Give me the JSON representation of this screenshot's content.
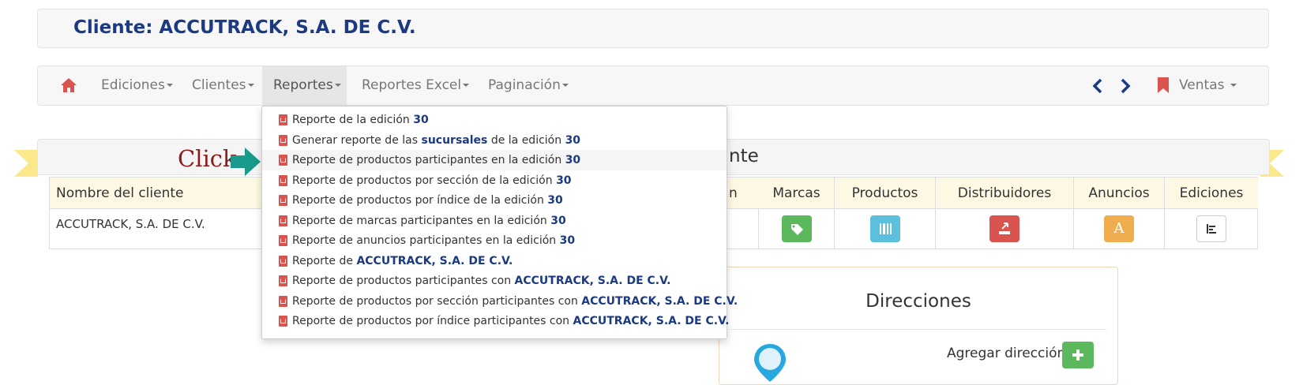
{
  "header": {
    "title": "Cliente: ACCUTRACK, S.A. DE C.V."
  },
  "navbar": {
    "items": [
      "Ediciones",
      "Clientes",
      "Reportes",
      "Reportes Excel",
      "Paginación"
    ],
    "right_label": "Ventas",
    "colors": {
      "home": "#d9534f",
      "arrows": "#1b3a82",
      "bookmark": "#d9534f"
    }
  },
  "dropdown": {
    "items": [
      {
        "text": "Reporte de la edición ",
        "bold": "30"
      },
      {
        "text": "Generar reporte de las ",
        "bold": "sucursales",
        "text2": " de la edición ",
        "bold2": "30"
      },
      {
        "text": "Reporte de productos participantes en la edición ",
        "bold": "30"
      },
      {
        "text": "Reporte de productos por sección de la edición ",
        "bold": "30"
      },
      {
        "text": "Reporte de productos por índice de la edición ",
        "bold": "30"
      },
      {
        "text": "Reporte de marcas participantes en la edición ",
        "bold": "30"
      },
      {
        "text": "Reporte de anuncios participantes en la edición ",
        "bold": "30"
      },
      {
        "text": "Reporte de ",
        "bold": "ACCUTRACK, S.A. DE C.V."
      },
      {
        "text": "Reporte de productos participantes con ",
        "bold": "ACCUTRACK, S.A. DE C.V."
      },
      {
        "text": "Reporte de productos por sección participantes con ",
        "bold": "ACCUTRACK, S.A. DE C.V."
      },
      {
        "text": "Reporte de productos por índice participantes con ",
        "bold": "ACCUTRACK, S.A. DE C.V."
      }
    ]
  },
  "annotation": {
    "click_label": "Click"
  },
  "panel": {
    "title_fragment": "nte"
  },
  "table": {
    "headers": [
      "Nombre del cliente",
      "n",
      "Marcas",
      "Productos",
      "Distribuidores",
      "Anuncios",
      "Ediciones"
    ],
    "row": {
      "name": "ACCUTRACK, S.A. DE C.V."
    },
    "button_colors": [
      "#5cb85c",
      "#5bc0de",
      "#d9534f",
      "#f0ad4e",
      "#ffffff"
    ],
    "anuncios_glyph": "A"
  },
  "direcciones": {
    "title": "Direcciones",
    "add_label": "Agregar dirección"
  }
}
